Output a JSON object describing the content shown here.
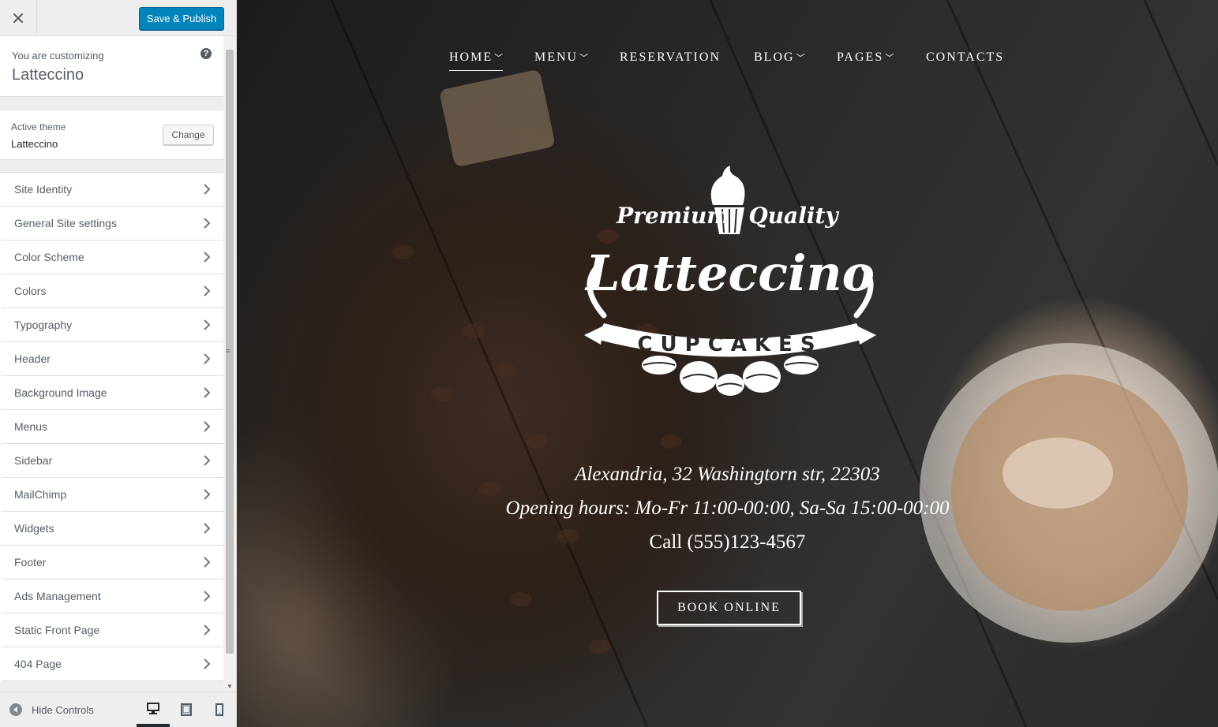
{
  "sidebar": {
    "save_label": "Save & Publish",
    "customizing_label": "You are customizing",
    "site_name": "Latteccino",
    "help_glyph": "?",
    "active_theme_label": "Active theme",
    "theme_name": "Latteccino",
    "change_label": "Change",
    "panels": [
      {
        "label": "Site Identity"
      },
      {
        "label": "General Site settings"
      },
      {
        "label": "Color Scheme"
      },
      {
        "label": "Colors"
      },
      {
        "label": "Typography"
      },
      {
        "label": "Header"
      },
      {
        "label": "Background Image"
      },
      {
        "label": "Menus"
      },
      {
        "label": "Sidebar"
      },
      {
        "label": "MailChimp"
      },
      {
        "label": "Widgets"
      },
      {
        "label": "Footer"
      },
      {
        "label": "Ads Management"
      },
      {
        "label": "Static Front Page"
      },
      {
        "label": "404 Page"
      }
    ],
    "hide_controls_label": "Hide Controls",
    "devices": [
      "desktop-icon",
      "tablet-icon",
      "mobile-icon"
    ],
    "active_device": "desktop"
  },
  "preview": {
    "nav": [
      {
        "label": "HOME",
        "has_dropdown": true,
        "active": true
      },
      {
        "label": "MENU",
        "has_dropdown": true
      },
      {
        "label": "RESERVATION",
        "has_dropdown": false
      },
      {
        "label": "BLOG",
        "has_dropdown": true
      },
      {
        "label": "PAGES",
        "has_dropdown": true
      },
      {
        "label": "CONTACTS",
        "has_dropdown": false
      }
    ],
    "logo": {
      "tagline_left": "Premium",
      "tagline_right": "Quality",
      "brand": "Latteccino",
      "ribbon": "CUPCAKES"
    },
    "address": "Alexandria, 32 Washingtorn str, 22303",
    "hours": "Opening hours: Mo-Fr 11:00-00:00, Sa-Sa 15:00-00:00",
    "phone": "Call (555)123-4567",
    "cta_label": "BOOK ONLINE"
  },
  "colors": {
    "primary_button": "#0085ba",
    "sidebar_bg": "#eeeeee",
    "text": "#555d66"
  }
}
